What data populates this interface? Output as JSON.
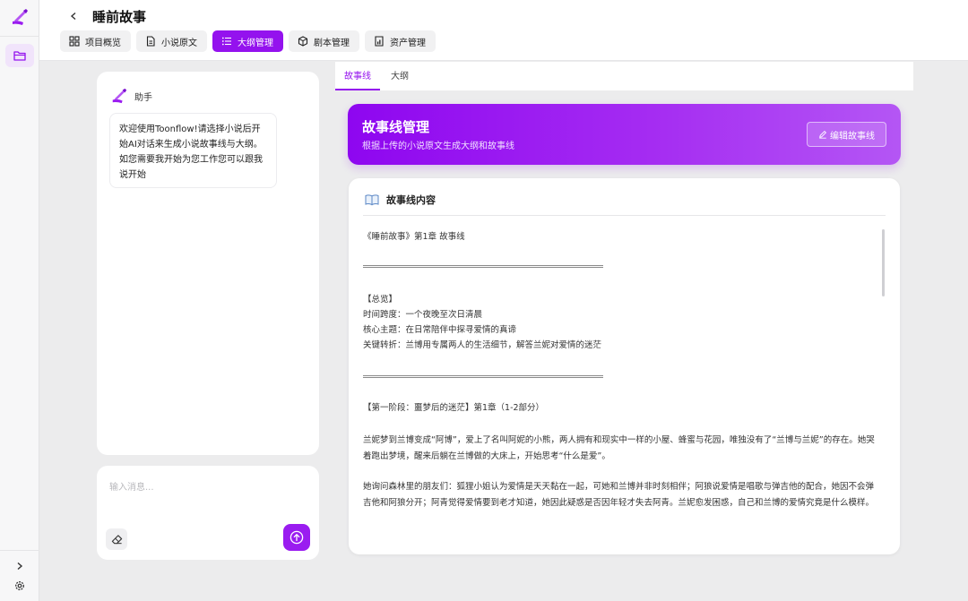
{
  "header": {
    "project_title": "睡前故事",
    "tabs": [
      {
        "label": "项目概览",
        "icon": "grid-icon",
        "active": false
      },
      {
        "label": "小说原文",
        "icon": "document-icon",
        "active": false
      },
      {
        "label": "大纲管理",
        "icon": "list-icon",
        "active": true
      },
      {
        "label": "剧本管理",
        "icon": "cube-icon",
        "active": false
      },
      {
        "label": "资产管理",
        "icon": "chart-file-icon",
        "active": false
      }
    ]
  },
  "assistant": {
    "name": "助手",
    "message": "欢迎使用Toonflow!请选择小说后开始AI对话来生成小说故事线与大纲。如您需要我开始为您工作您可以跟我说开始",
    "input_placeholder": "输入消息..."
  },
  "content_tabs": [
    {
      "label": "故事线",
      "active": true
    },
    {
      "label": "大纲",
      "active": false
    }
  ],
  "banner": {
    "title": "故事线管理",
    "subtitle": "根据上传的小说原文生成大纲和故事线",
    "edit_button": "编辑故事线"
  },
  "storyline": {
    "heading": "故事线内容",
    "chapter_title": "《睡前故事》第1章 故事线",
    "overview_label": "【总览】",
    "time_span": "时间跨度：一个夜晚至次日清晨",
    "core_theme": "核心主题：在日常陪伴中探寻爱情的真谛",
    "key_turn": "关键转折：兰博用专属两人的生活细节，解答兰妮对爱情的迷茫",
    "stage1_label": "【第一阶段：噩梦后的迷茫】第1章（1-2部分）",
    "stage1_para1": "兰妮梦到兰博变成“阿博”，爱上了名叫阿妮的小熊，两人拥有和现实中一样的小屋、蜂蜜与花园，唯独没有了“兰博与兰妮”的存在。她哭着跑出梦境，醒来后躺在兰博做的大床上，开始思考“什么是爱”。",
    "stage1_para2": "她询问森林里的朋友们：狐狸小姐认为爱情是天天黏在一起，可她和兰博并非时刻相伴；阿狼说爱情是唱歌与弹吉他的配合，她因不会弹吉他和阿狼分开；阿青觉得爱情要到老才知道，她因此疑惑是否因年轻才失去阿青。兰妮愈发困惑，自己和兰博的爱情究竟是什么模样。"
  },
  "colors": {
    "accent": "#9412ee",
    "banner_start": "#8e06f0",
    "banner_end": "#b456f4",
    "page_bg": "#ececed"
  }
}
